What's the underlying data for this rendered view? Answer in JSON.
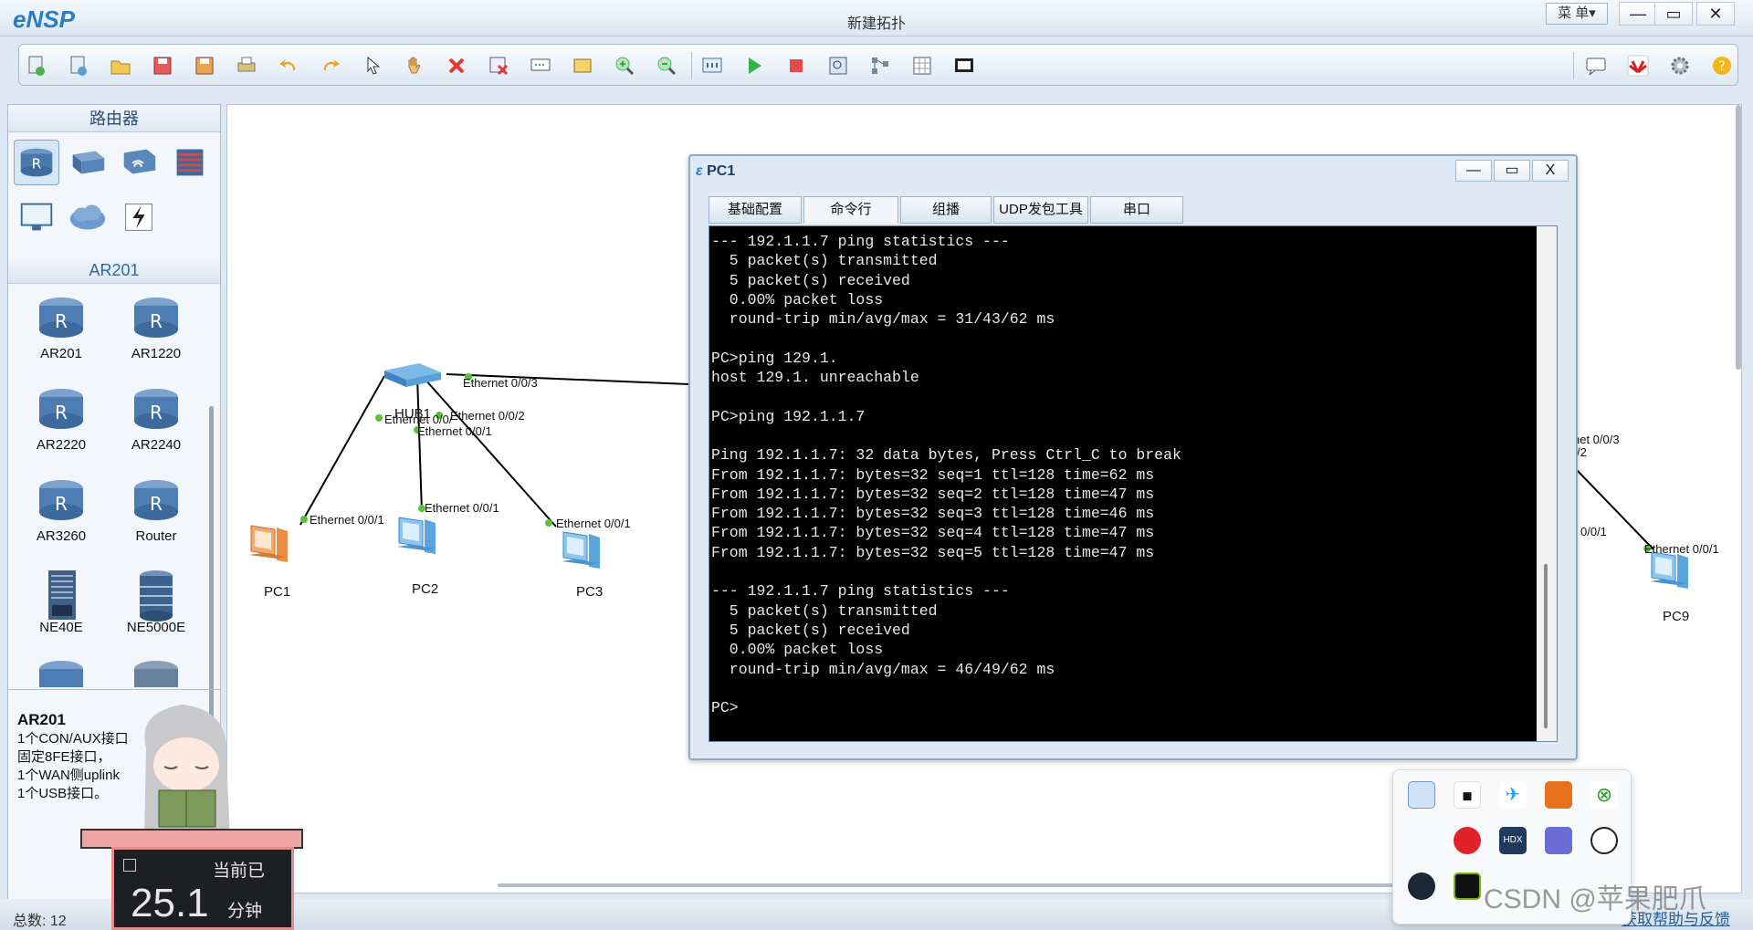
{
  "app": {
    "name": "eNSP",
    "window_title": "新建拓扑",
    "menu_label": "菜 单▾",
    "min": "—",
    "max": "▭",
    "close": "✕"
  },
  "toolbar": {
    "left_icons": [
      "new-topology-icon",
      "new-example-icon",
      "open-icon",
      "save-icon",
      "save-as-icon",
      "print-icon",
      "undo-icon",
      "redo-icon",
      "select-icon",
      "pan-hand-icon",
      "delete-icon",
      "delete-links-icon",
      "text-icon",
      "palette-icon",
      "zoom-in-icon",
      "zoom-out-icon",
      "fit-icon",
      "start-all-icon",
      "stop-all-icon",
      "capture-icon",
      "topology-icon",
      "grid-icon",
      "screen-icon"
    ],
    "right_icons": [
      "chat-icon",
      "huawei-icon",
      "settings-icon",
      "help-icon"
    ]
  },
  "left_panel": {
    "category_header": "路由器",
    "categories": [
      "router-category-icon",
      "switch-category-icon",
      "wireless-category-icon",
      "firewall-category-icon",
      "pc-category-icon",
      "cloud-category-icon",
      "link-category-icon"
    ],
    "device_header": "AR201",
    "devices": [
      "AR201",
      "AR1220",
      "AR2220",
      "AR2240",
      "AR3260",
      "Router",
      "NE40E",
      "NE5000E"
    ],
    "desc_title": "AR201",
    "desc_lines": [
      "1个CON/AUX接口",
      "固定8FE接口，",
      "1个WAN侧uplink",
      "1个USB接口。"
    ]
  },
  "canvas": {
    "nodes": {
      "hub": "HUB1",
      "pc1": "PC1",
      "pc2": "PC2",
      "pc3": "PC3",
      "pc9": "PC9"
    },
    "ports": {
      "hub_e3": "Ethernet 0/0/3",
      "hub_e0": "Ethernet 0/0/",
      "hub_e2": "Ethernet 0/0/2",
      "hub_e1": "Ethernet 0/0/1",
      "pc1_e1": "Ethernet 0/0/1",
      "pc2_e1": "Ethernet 0/0/1",
      "pc3_e1": "Ethernet 0/0/1",
      "r_e3": "net 0/0/3",
      "r_e2": "/2",
      "r_e1": "0/0/1",
      "pc9_e1": "Ethernet 0/0/1"
    }
  },
  "dialog": {
    "title": "PC1",
    "tabs": [
      "基础配置",
      "命令行",
      "组播",
      "UDP发包工具",
      "串口"
    ],
    "active_tab": "命令行",
    "terminal": "--- 192.1.1.7 ping statistics ---\n  5 packet(s) transmitted\n  5 packet(s) received\n  0.00% packet loss\n  round-trip min/avg/max = 31/43/62 ms\n\nPC>ping 129.1.\nhost 129.1. unreachable\n\nPC>ping 192.1.1.7\n\nPing 192.1.1.7: 32 data bytes, Press Ctrl_C to break\nFrom 192.1.1.7: bytes=32 seq=1 ttl=128 time=62 ms\nFrom 192.1.1.7: bytes=32 seq=2 ttl=128 time=47 ms\nFrom 192.1.1.7: bytes=32 seq=3 ttl=128 time=46 ms\nFrom 192.1.1.7: bytes=32 seq=4 ttl=128 time=47 ms\nFrom 192.1.1.7: bytes=32 seq=5 ttl=128 time=47 ms\n\n--- 192.1.1.7 ping statistics ---\n  5 packet(s) transmitted\n  5 packet(s) received\n  0.00% packet loss\n  round-trip min/avg/max = 46/49/62 ms\n\nPC>"
  },
  "statusbar": {
    "count": "总数: 12",
    "help": "获取帮助与反馈"
  },
  "timer": {
    "title": "当前已",
    "value": "25.1",
    "unit": "分钟"
  },
  "tray_icons": [
    "paint-app-icon",
    "notion-icon",
    "feishu-icon",
    "app-orange-icon",
    "xbox-icon",
    "blank-icon",
    "netease-music-icon",
    "hdx-icon",
    "teams-icon",
    "chatgpt-icon",
    "steam-icon",
    "nvidia-icon"
  ],
  "watermark": "CSDN @苹果肥爪",
  "colors": {
    "accent": "#2a7cc5",
    "terminal_bg": "#000000",
    "terminal_fg": "#e8e8e8",
    "link_dot": "#5cc13a"
  }
}
